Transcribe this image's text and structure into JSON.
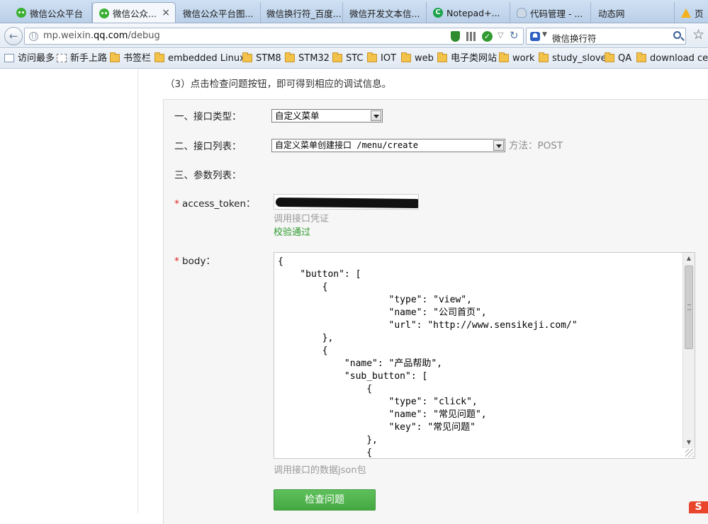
{
  "browser": {
    "tabs": [
      {
        "label": "微信公众平台",
        "icon": "wechat-icon"
      },
      {
        "label": "微信公众...",
        "icon": "wechat-icon",
        "close": "×"
      },
      {
        "label": "微信公众平台图..."
      },
      {
        "label": "微信换行符_百度..."
      },
      {
        "label": "微信开发文本信..."
      },
      {
        "label": "Notepad+...",
        "icon": "notepad-icon",
        "icon_text": "C"
      },
      {
        "label": "代码管理 - ...",
        "icon": "cloud-icon"
      },
      {
        "label": "动态网"
      },
      {
        "label": "页",
        "icon": "warning-icon"
      }
    ],
    "url_prefix": "mp.weixin.",
    "url_domain": "qq.com",
    "url_path": "/debug",
    "search_text": "微信换行符",
    "bookmarks": [
      {
        "label": "访问最多",
        "icon": "grid-icon"
      },
      {
        "label": "新手上路",
        "icon": "dashed-icon"
      },
      {
        "label": "书签栏",
        "icon": "folder-icon"
      },
      {
        "label": "embedded Linux",
        "icon": "folder-icon"
      },
      {
        "label": "STM8",
        "icon": "folder-icon"
      },
      {
        "label": "STM32",
        "icon": "folder-icon"
      },
      {
        "label": "STC",
        "icon": "folder-icon"
      },
      {
        "label": "IOT",
        "icon": "folder-icon"
      },
      {
        "label": "web",
        "icon": "folder-icon"
      },
      {
        "label": "电子类网站",
        "icon": "folder-icon"
      },
      {
        "label": "work",
        "icon": "folder-icon"
      },
      {
        "label": "study_slove",
        "icon": "folder-icon"
      },
      {
        "label": "QA",
        "icon": "folder-icon"
      },
      {
        "label": "download cen",
        "icon": "folder-icon"
      }
    ]
  },
  "page": {
    "step_note": "（3）点击检查问题按钮，即可得到相应的调试信息。",
    "interface_type_label": "一、接口类型：",
    "interface_type_value": "自定义菜单",
    "interface_list_label": "二、接口列表：",
    "interface_list_value": "自定义菜单创建接口 /menu/create",
    "method": "方法：POST",
    "params_label": "三、参数列表：",
    "access_token_required": "*",
    "access_token_label": "access_token：",
    "access_token_hint": "调用接口凭证",
    "access_token_status": "校验通过",
    "body_required": "*",
    "body_label": "body：",
    "body_code": "{\n    \"button\": [\n        {\n                    \"type\": \"view\",\n                    \"name\": \"公司首页\",\n                    \"url\": \"http://www.sensikeji.com/\"\n        },\n        {\n            \"name\": \"产品帮助\",\n            \"sub_button\": [\n                {\n                    \"type\": \"click\",\n                    \"name\": \"常见问题\",\n                    \"key\": \"常见问题\"\n                },\n                {",
    "body_hint": "调用接口的数据json包",
    "check_button": "检查问题",
    "sogou_badge": "S"
  },
  "colors": {
    "accent_green": "#44a842",
    "valid_green": "#2e9a2e",
    "required_red": "#e02020"
  }
}
